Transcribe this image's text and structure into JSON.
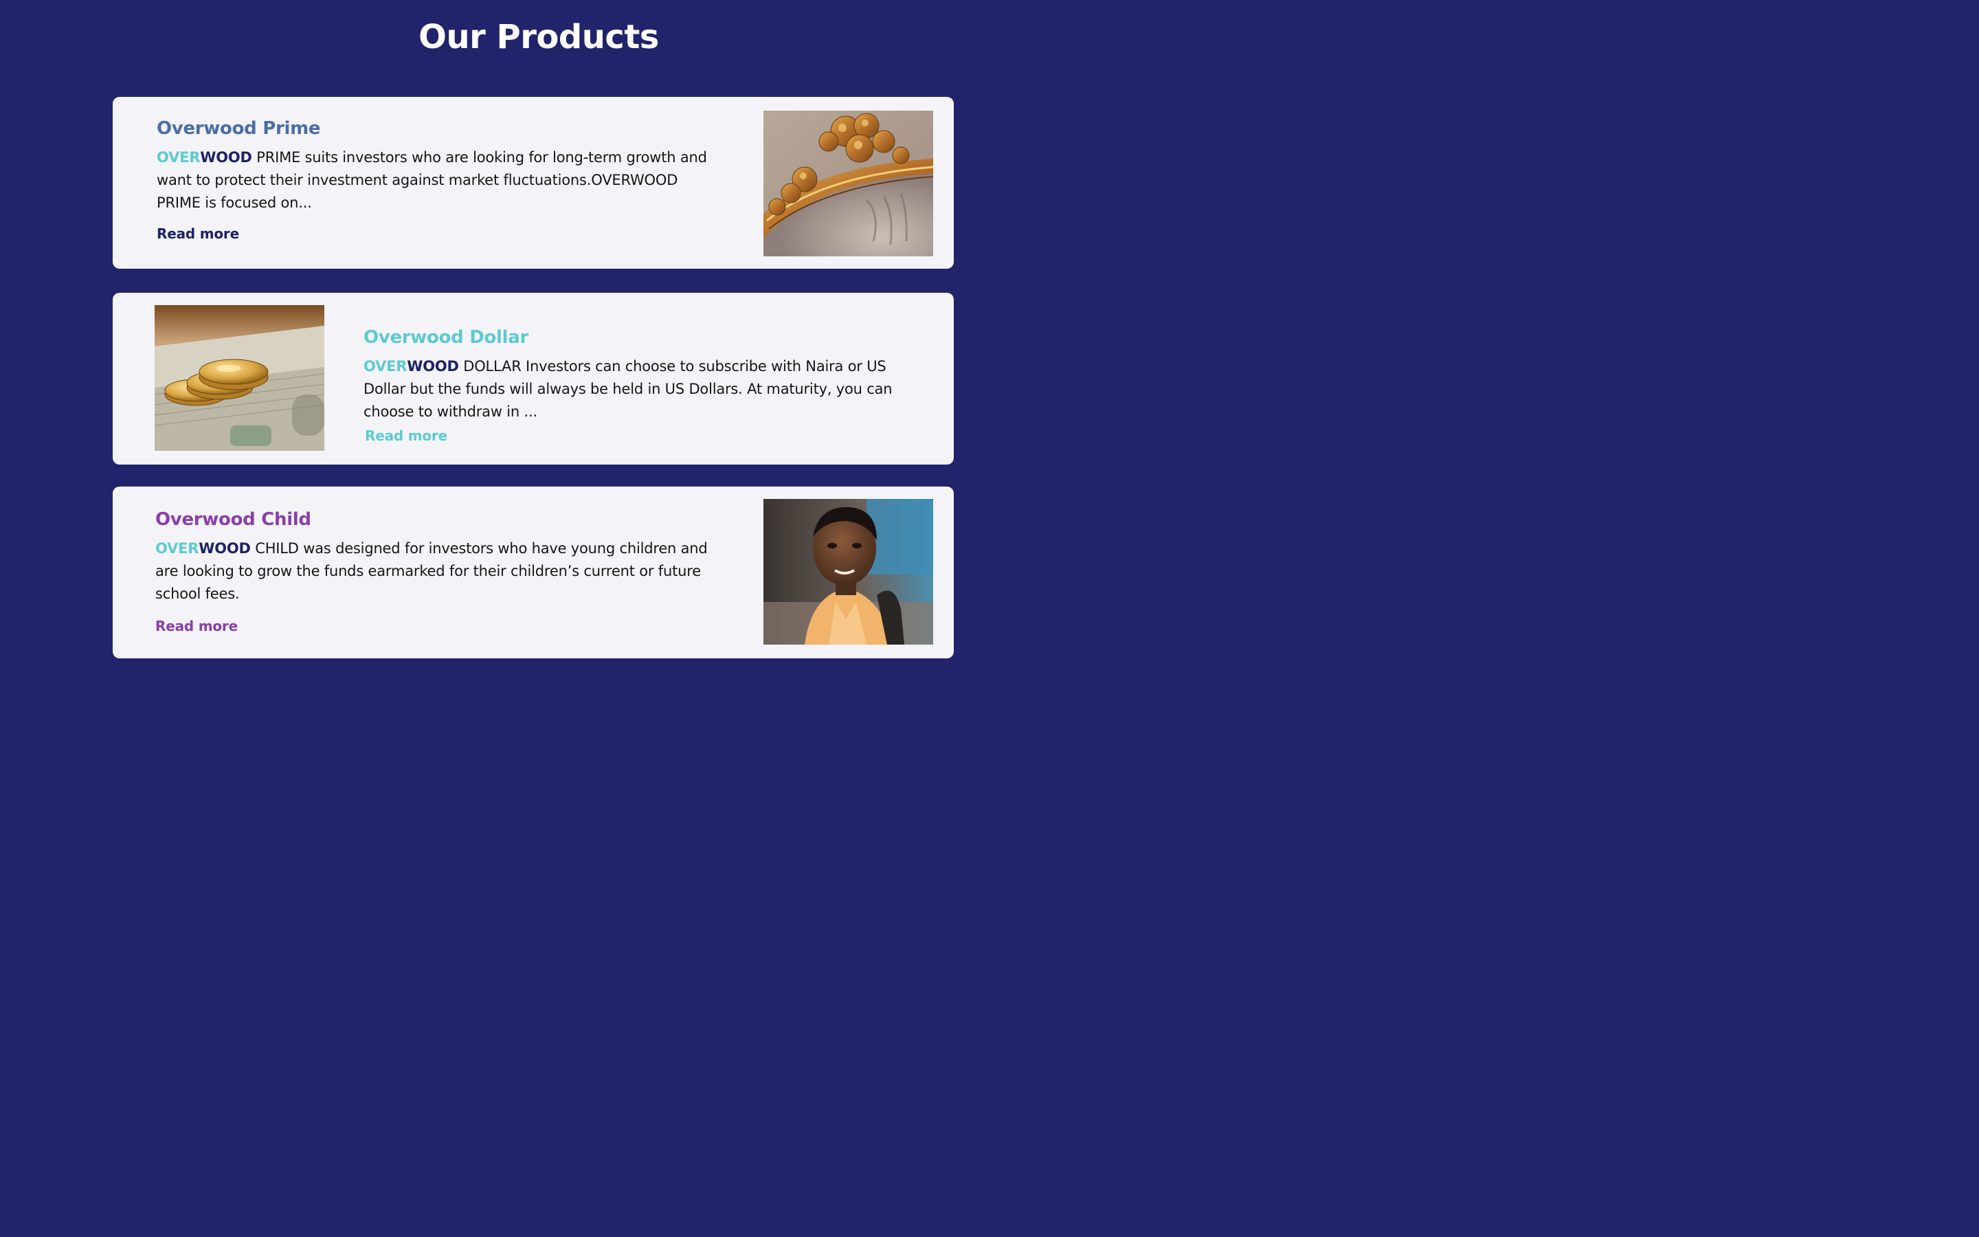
{
  "page": {
    "title": "Our Products"
  },
  "colors": {
    "background": "#21246b",
    "card": "#f4f4f8",
    "over_teal": "#5ccbd0",
    "wood_navy": "#1d2366"
  },
  "products": [
    {
      "title": "Overwood Prime",
      "title_color": "#4a6ea6",
      "brand_over": "OVER",
      "brand_wood": "WOOD",
      "description": " PRIME suits investors who are looking for long-term growth and want to protect their investment against market fluctuations.OVERWOOD PRIME is focused on...",
      "read_more": "Read more",
      "read_more_color": "#1d2366",
      "image_icon": "ornate-gold-frame-image"
    },
    {
      "title": "Overwood Dollar",
      "title_color": "#5ccbd0",
      "brand_over": "OVER",
      "brand_wood": "WOOD",
      "description": " DOLLAR Investors can choose to subscribe with Naira or US Dollar but the funds will always be held in US Dollars. At maturity, you can choose to withdraw in ...",
      "read_more": "Read more",
      "read_more_color": "#5ccbd0",
      "image_icon": "gold-coins-on-dollars-image"
    },
    {
      "title": "Overwood Child",
      "title_color": "#8a3fa8",
      "brand_over": "OVER",
      "brand_wood": "WOOD",
      "description": " CHILD was designed for investors who have young children and are looking to grow the funds earmarked for their children’s current or future school fees.",
      "read_more": "Read more",
      "read_more_color": "#8a3fa8",
      "image_icon": "child-portrait-image"
    }
  ]
}
